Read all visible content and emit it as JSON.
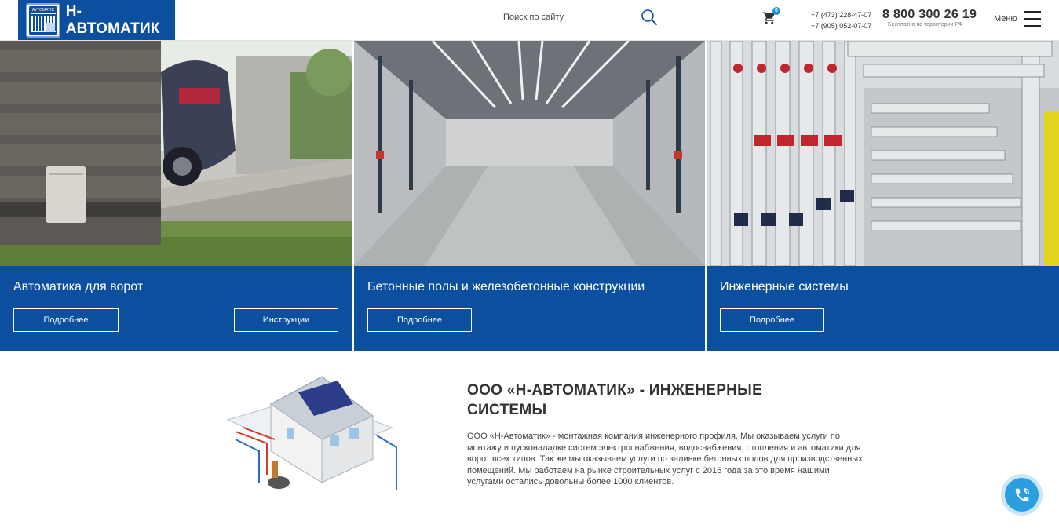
{
  "header": {
    "logo_text": "Н-АВТОМАТИК",
    "logo_emblem_text": "AVTOMATIC",
    "search_placeholder": "Поиск по сайту",
    "cart_count": "0",
    "phone_1": "+7 (473) 228-47-07",
    "phone_2": "+7 (905) 052-07-07",
    "phone_main": "8 800 300 26 19",
    "phone_note": "Бесплатно по территории РФ",
    "menu_label": "Меню"
  },
  "cards": [
    {
      "title": "Автоматика для ворот",
      "button_more": "Подробнее",
      "button_instructions": "Инструкции",
      "image_icon": "gate-automation-photo"
    },
    {
      "title": "Бетонные полы и железобетонные конструкции",
      "button_more": "Подробнее",
      "image_icon": "warehouse-floor-photo"
    },
    {
      "title": "Инженерные системы",
      "button_more": "Подробнее",
      "image_icon": "boiler-room-pipes-photo"
    }
  ],
  "about": {
    "title": "ООО «Н-АВТОМАТИК» - ИНЖЕНЕРНЫЕ СИСТЕМЫ",
    "text": "ООО «Н-Автоматик» - монтажная компания инженерного профиля. Мы оказываем услуги по монтажу и пусконаладке систем электроснабжения, водоснабжения, отопления и автоматики для ворот всех типов. Так же мы оказываем услуги по заливке бетонных полов для производственных помещений. Мы работаем на рынке строительных услуг с 2016 года за это время нашими услугами остались довольны более 1000 клиентов.",
    "image_icon": "house-engineering-diagram"
  },
  "colors": {
    "brand_blue": "#0b4f9e",
    "call_button": "#2a9fe0"
  }
}
